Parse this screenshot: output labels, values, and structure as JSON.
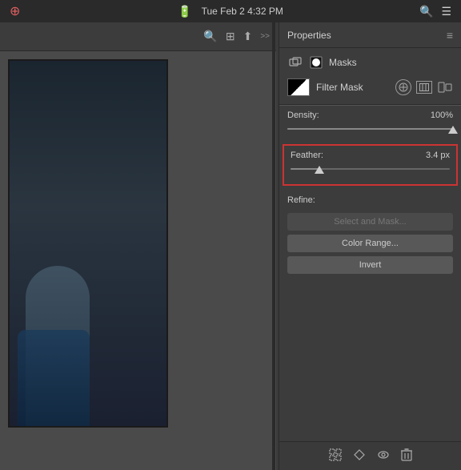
{
  "menubar": {
    "icons_left": [
      "●",
      "●"
    ],
    "time": "Tue Feb 2  4:32 PM",
    "icons_right": [
      "🔍",
      "☰"
    ]
  },
  "canvas_toolbar": {
    "search_icon": "🔍",
    "layout_icon": "⊞",
    "export_icon": "⬆"
  },
  "panel": {
    "title": "Properties",
    "menu_icon": "≡",
    "sections": {
      "masks": {
        "label": "Masks",
        "filter_mask_label": "Filter Mask"
      },
      "density": {
        "label": "Density:",
        "value": "100%"
      },
      "feather": {
        "label": "Feather:",
        "value": "3.4 px"
      },
      "refine": {
        "label": "Refine:",
        "select_mask_btn": "Select and Mask...",
        "color_range_btn": "Color Range...",
        "invert_btn": "Invert"
      }
    }
  },
  "bottom_toolbar": {
    "icons": [
      "⊞",
      "◇",
      "👁",
      "🗑"
    ]
  }
}
